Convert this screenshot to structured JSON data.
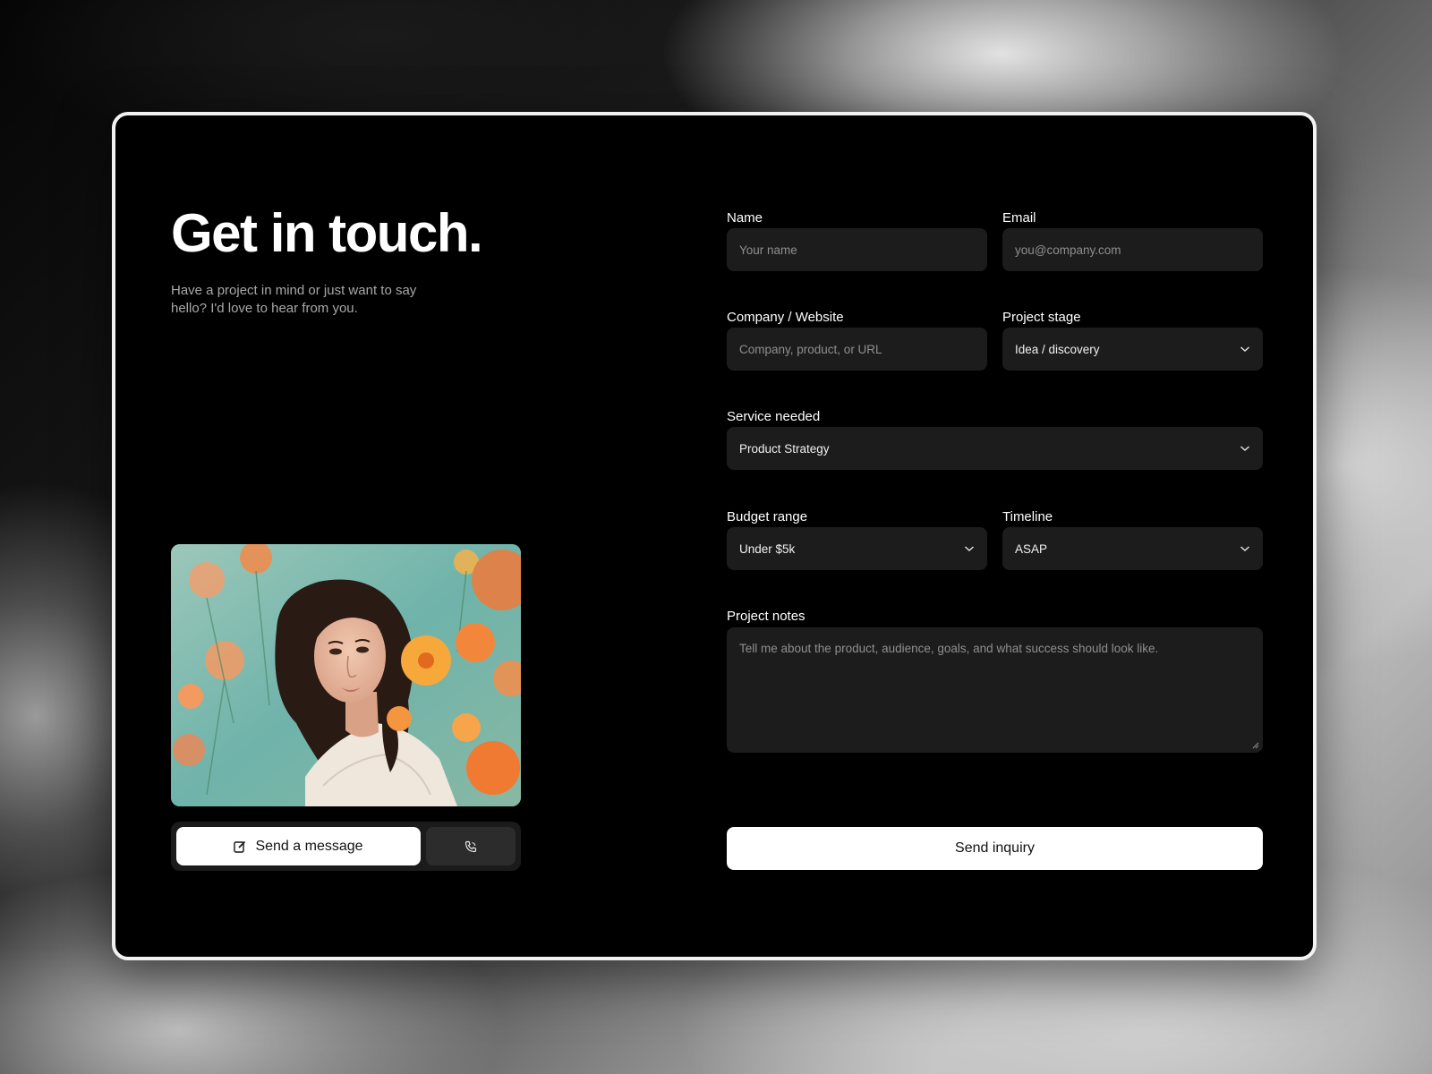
{
  "hero": {
    "headline": "Get in touch.",
    "subtext": "Have a project in mind or just want to say hello? I'd love to hear from you."
  },
  "actions": {
    "message_label": "Send a message",
    "message_icon": "edit-icon",
    "call_icon": "phone-icon"
  },
  "form": {
    "name": {
      "label": "Name",
      "placeholder": "Your name"
    },
    "email": {
      "label": "Email",
      "placeholder": "you@company.com"
    },
    "company": {
      "label": "Company / Website",
      "placeholder": "Company, product, or URL"
    },
    "project_stage": {
      "label": "Project stage",
      "value": "Idea / discovery"
    },
    "service": {
      "label": "Service needed",
      "value": "Product Strategy"
    },
    "budget": {
      "label": "Budget range",
      "value": "Under $5k"
    },
    "timeline": {
      "label": "Timeline",
      "value": "ASAP"
    },
    "notes": {
      "label": "Project notes",
      "placeholder": "Tell me about the product, audience, goals, and what success should look like."
    },
    "submit_label": "Send inquiry"
  },
  "colors": {
    "card_bg": "#000000",
    "field_bg": "#1c1c1c",
    "button_bg": "#ffffff",
    "text_primary": "#ffffff",
    "text_muted": "#8f8f8f"
  }
}
